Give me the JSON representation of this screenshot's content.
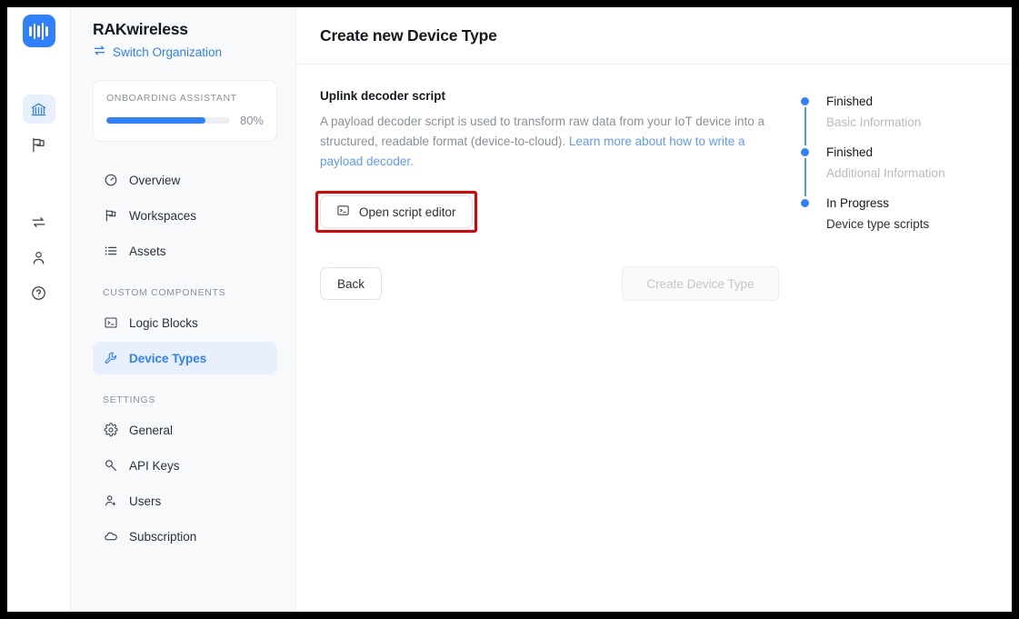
{
  "brand": {
    "logo_icon": "audio-wave-logo",
    "org_name": "RAKwireless",
    "switch_org_label": "Switch Organization",
    "switch_org_icon": "swap-arrows-icon"
  },
  "colors": {
    "accent": "#2f80ff",
    "accent_soft": "#e8f0fe",
    "link": "#5d9bff",
    "highlight": "#e40000",
    "muted_text": "#8a9099",
    "sidebar_bg": "#f8f9fa",
    "border": "#eceef1"
  },
  "icon_rail": {
    "items": [
      {
        "name": "organization-icon",
        "icon": "bank-icon",
        "active": true
      },
      {
        "name": "workspaces-icon",
        "icon": "flag-icon",
        "active": false
      },
      {
        "name": "transfer-icon",
        "icon": "repeat-icon",
        "active": false
      },
      {
        "name": "account-icon",
        "icon": "user-icon",
        "active": false
      },
      {
        "name": "help-icon",
        "icon": "question-circle-icon",
        "active": false
      }
    ]
  },
  "onboarding": {
    "title": "ONBOARDING ASSISTANT",
    "percent_label": "80%",
    "percent_value": 80
  },
  "sidebar": {
    "items": [
      {
        "label": "Overview",
        "icon": "gauge-icon",
        "active": false
      },
      {
        "label": "Workspaces",
        "icon": "flag-icon",
        "active": false
      },
      {
        "label": "Assets",
        "icon": "list-icon",
        "active": false
      }
    ],
    "group_custom_components": {
      "title": "CUSTOM COMPONENTS",
      "items": [
        {
          "label": "Logic Blocks",
          "icon": "terminal-icon",
          "active": false
        },
        {
          "label": "Device Types",
          "icon": "wrench-icon",
          "active": true
        }
      ]
    },
    "group_settings": {
      "title": "SETTINGS",
      "items": [
        {
          "label": "General",
          "icon": "gear-icon",
          "active": false
        },
        {
          "label": "API Keys",
          "icon": "key-icon",
          "active": false
        },
        {
          "label": "Users",
          "icon": "user-add-icon",
          "active": false
        },
        {
          "label": "Subscription",
          "icon": "cloud-icon",
          "active": false
        }
      ]
    }
  },
  "main": {
    "page_title": "Create new Device Type",
    "section": {
      "title": "Uplink decoder script",
      "description": "A payload decoder script is used to transform raw data from your IoT device into a structured, readable format (device-to-cloud).",
      "link_text": "Learn more about how to write a payload decoder."
    },
    "script_button": {
      "label": "Open script editor",
      "icon": "terminal-icon",
      "highlighted": true
    },
    "actions": {
      "back_label": "Back",
      "create_label": "Create Device Type",
      "create_disabled": true
    }
  },
  "stepper": {
    "steps": [
      {
        "status": "Finished",
        "label": "Basic Information",
        "current": false
      },
      {
        "status": "Finished",
        "label": "Additional Information",
        "current": false
      },
      {
        "status": "In Progress",
        "label": "Device type scripts",
        "current": true
      }
    ]
  }
}
